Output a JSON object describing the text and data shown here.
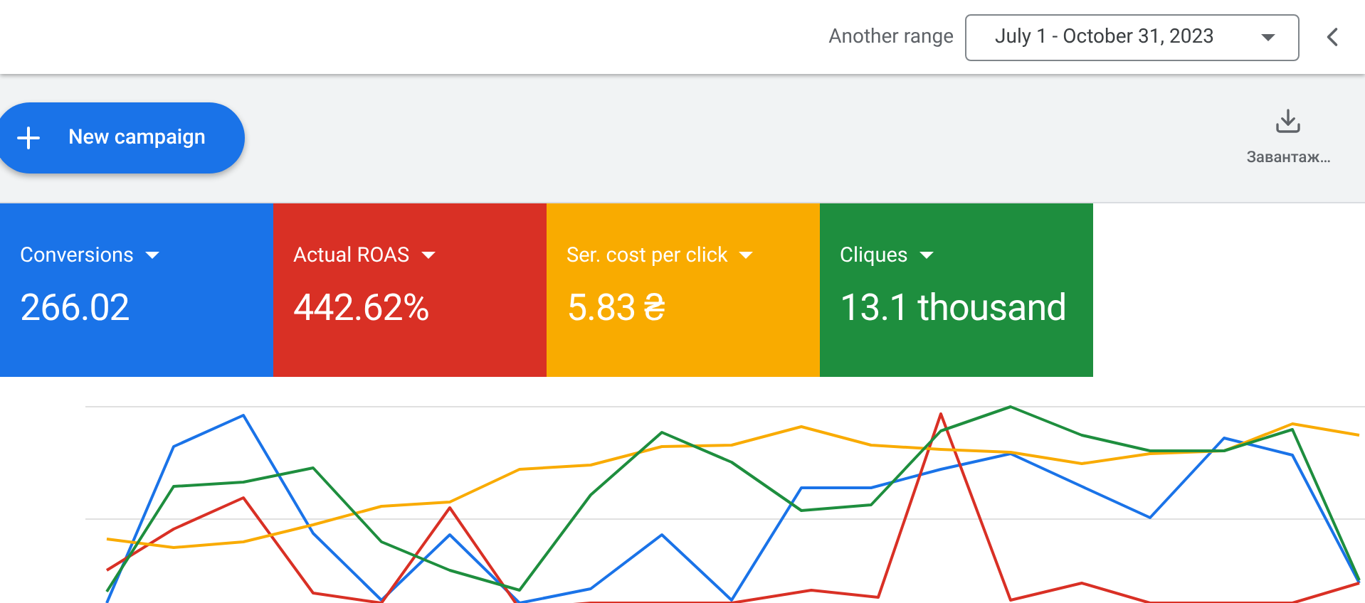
{
  "top_bar": {
    "range_label": "Another range",
    "date_range": "July 1 - October 31, 2023"
  },
  "toolbar": {
    "new_button": "New campaign",
    "download_label": "Завантаж…"
  },
  "metric_cards": [
    {
      "label": "Conversions",
      "value": "266.02",
      "color": "#1a73e8"
    },
    {
      "label": "Actual ROAS",
      "value": "442.62%",
      "color": "#d93025"
    },
    {
      "label": "Ser. cost per click",
      "value": "5.83 ₴",
      "color": "#f9ab00"
    },
    {
      "label": "Cliques",
      "value": "13.1 thousand",
      "color": "#1e8e3e"
    }
  ]
}
